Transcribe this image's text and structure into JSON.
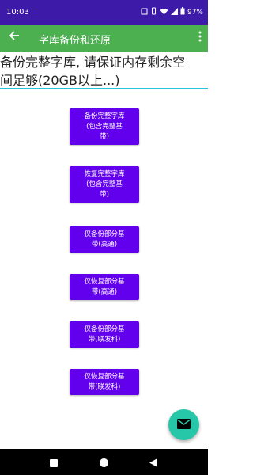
{
  "status": {
    "time": "10:03",
    "battery": "97%"
  },
  "appbar": {
    "back_icon": "arrow-back-icon",
    "title": "字库备份和还原",
    "more_icon": "more-vert-icon"
  },
  "notice": {
    "line1": "备份完整字库, 请保证内存剩余空",
    "line2": "间足够(20GB以上...)"
  },
  "buttons": [
    {
      "line1": "备份完整字库",
      "line2": "(包含完整基",
      "line3": "带)"
    },
    {
      "line1": "恢复完整字库",
      "line2": "(包含完整基",
      "line3": "带)"
    },
    {
      "line1": "仅备份部分基",
      "line2": "带(高通)"
    },
    {
      "line1": "仅恢复部分基",
      "line2": "带(高通)"
    },
    {
      "line1": "仅备份部分基",
      "line2": "带(联发科)"
    },
    {
      "line1": "仅恢复部分基",
      "line2": "带(联发科)"
    }
  ],
  "fab": {
    "icon": "email-icon"
  },
  "colors": {
    "status_bar": "#3d1aa8",
    "appbar": "#4caf50",
    "button": "#6200ee",
    "fab": "#26c6a8",
    "field_underline": "#26c6da"
  }
}
